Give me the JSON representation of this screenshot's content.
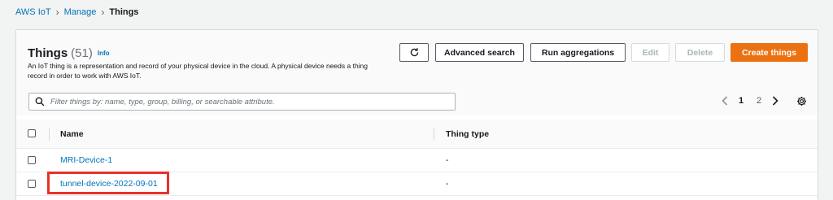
{
  "breadcrumb": {
    "items": [
      "AWS IoT",
      "Manage"
    ],
    "current": "Things"
  },
  "panel": {
    "title": "Things",
    "count": "(51)",
    "info": "Info",
    "description": "An IoT thing is a representation and record of your physical device in the cloud. A physical device needs a thing record in order to work with AWS IoT."
  },
  "toolbar": {
    "refresh_icon": "refresh-icon",
    "advanced_search": "Advanced search",
    "run_aggregations": "Run aggregations",
    "edit": "Edit",
    "delete": "Delete",
    "create": "Create things"
  },
  "search": {
    "placeholder": "Filter things by: name, type, group, billing, or searchable attribute."
  },
  "pagination": {
    "pages": [
      "1",
      "2"
    ],
    "current_page": "1"
  },
  "table": {
    "columns": [
      "Name",
      "Thing type"
    ],
    "rows": [
      {
        "name": "MRI-Device-1",
        "type": "-"
      },
      {
        "name": "tunnel-device-2022-09-01",
        "type": "-"
      }
    ]
  },
  "colors": {
    "link": "#0073bb",
    "primary": "#ec7211",
    "highlight": "#e8312a"
  }
}
